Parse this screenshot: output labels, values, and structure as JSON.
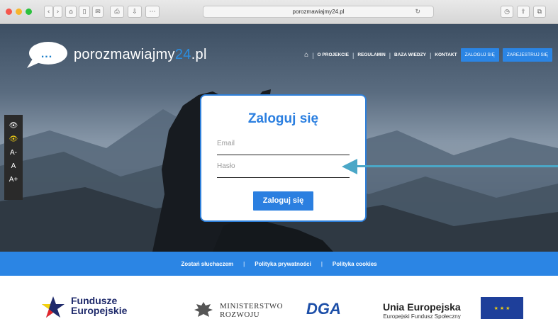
{
  "browser": {
    "url": "porozmawiajmy24.pl",
    "traffic_light_colors": [
      "#f5564c",
      "#f7b52c",
      "#2bc13e"
    ]
  },
  "site": {
    "logo_dots": "...",
    "brand_main": "porozmawiajmy",
    "brand_accent": "24",
    "brand_suffix": ".pl"
  },
  "nav": {
    "items": [
      "O PROJEKCIE",
      "REGULAMIN",
      "BAZA WIEDZY",
      "KONTAKT"
    ],
    "login_button": "ZALOGUJ SIĘ",
    "register_button": "ZAREJESTRUJ SIĘ"
  },
  "accessibility": {
    "contrast_normal": "normal-contrast-icon",
    "contrast_high": "high-contrast-icon",
    "font_small": "A-",
    "font_normal": "A",
    "font_large": "A+"
  },
  "login": {
    "title": "Zaloguj się",
    "email_placeholder": "Email",
    "password_placeholder": "Hasło",
    "submit_label": "Zaloguj się",
    "accent_color": "#2b7fe0"
  },
  "footer": {
    "links": [
      "Zostań słuchaczem",
      "Polityka prywatności",
      "Polityka cookies"
    ]
  },
  "partners": {
    "fe_line1": "Fundusze",
    "fe_line2": "Europejskie",
    "ministry_line1": "MINISTERSTWO",
    "ministry_line2": "ROZWOJU",
    "dga": "DGA",
    "ue_title": "Unia Europejska",
    "ue_subtitle": "Europejski Fundusz Społeczny"
  }
}
